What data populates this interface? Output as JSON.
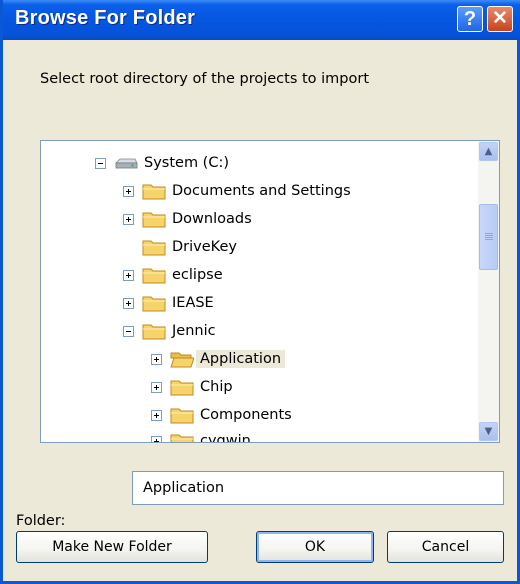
{
  "window": {
    "title": "Browse For Folder"
  },
  "title_buttons": {
    "help_label": "?",
    "close_label": "✕"
  },
  "prompt": "Select root directory of the projects to import",
  "tree": {
    "items": [
      {
        "label": "System (C:)",
        "icon": "drive-icon",
        "expander": "minus"
      },
      {
        "label": "Documents and Settings",
        "icon": "folder-icon",
        "expander": "plus"
      },
      {
        "label": "Downloads",
        "icon": "folder-icon",
        "expander": "plus"
      },
      {
        "label": "DriveKey",
        "icon": "folder-icon",
        "expander": "none"
      },
      {
        "label": "eclipse",
        "icon": "folder-icon",
        "expander": "plus"
      },
      {
        "label": "IEASE",
        "icon": "folder-icon",
        "expander": "plus"
      },
      {
        "label": "Jennic",
        "icon": "folder-icon",
        "expander": "minus"
      },
      {
        "label": "Application",
        "icon": "open-folder-icon",
        "expander": "plus",
        "selected": true
      },
      {
        "label": "Chip",
        "icon": "folder-icon",
        "expander": "plus"
      },
      {
        "label": "Components",
        "icon": "folder-icon",
        "expander": "plus"
      },
      {
        "label": "cygwin",
        "icon": "folder-icon",
        "expander": "plus"
      }
    ]
  },
  "folder_field": {
    "label": "Folder:",
    "value": "Application"
  },
  "buttons": {
    "make_new_folder": "Make New Folder",
    "ok": "OK",
    "cancel": "Cancel"
  },
  "colors": {
    "title_bar": "#0656e0",
    "dialog_bg": "#ece9d8",
    "folder": "#f7d36b"
  }
}
